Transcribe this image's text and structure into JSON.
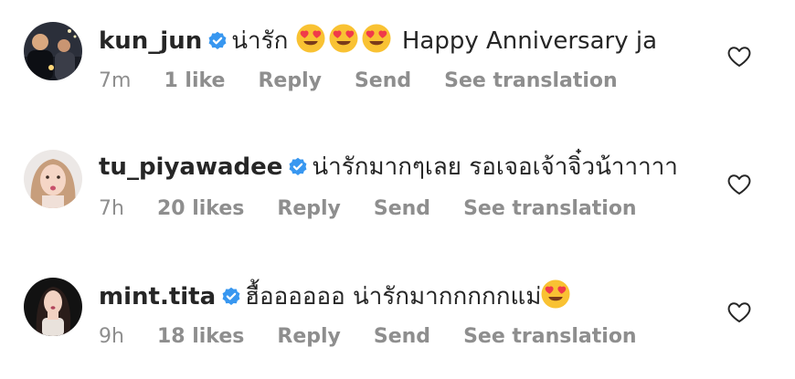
{
  "comments": [
    {
      "username": "kun_jun",
      "verified": true,
      "text": "น่ารัก",
      "emoji_count": 3,
      "text_after": "Happy Anniversary ja",
      "time": "7m",
      "likes": "1 like",
      "reply_label": "Reply",
      "send_label": "Send",
      "translate_label": "See translation",
      "avatar_icon": "profile-photo-man-night",
      "like_icon": "heart-outline-icon"
    },
    {
      "username": "tu_piyawadee",
      "verified": true,
      "text": "น่ารักมากๆเลย รอเจอเจ้าจิ๋วน้าาาาา",
      "emoji_count": 0,
      "text_after": "",
      "time": "7h",
      "likes": "20 likes",
      "reply_label": "Reply",
      "send_label": "Send",
      "translate_label": "See translation",
      "avatar_icon": "profile-photo-woman",
      "like_icon": "heart-outline-icon"
    },
    {
      "username": "mint.tita",
      "verified": true,
      "text": "ฮื้ออออออ น่ารักมากกกกกแม่",
      "emoji_count": 1,
      "text_after": "",
      "time": "9h",
      "likes": "18 likes",
      "reply_label": "Reply",
      "send_label": "Send",
      "translate_label": "See translation",
      "avatar_icon": "profile-photo-woman-dark",
      "like_icon": "heart-outline-icon"
    }
  ],
  "colors": {
    "verified": "#3897f0",
    "meta_text": "#8e8e8e",
    "emoji_face": "#f9c233",
    "emoji_heart": "#f03a4a"
  }
}
